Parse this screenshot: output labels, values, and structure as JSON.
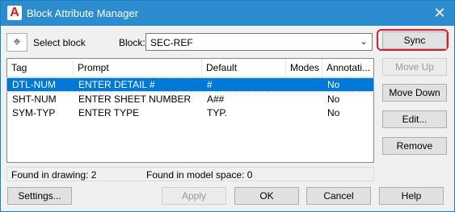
{
  "window": {
    "title": "Block Attribute Manager"
  },
  "toolbar": {
    "select_block_label": "Select block",
    "block_label": "Block:",
    "block_value": "SEC-REF"
  },
  "table": {
    "columns": [
      "Tag",
      "Prompt",
      "Default",
      "Modes",
      "Annotati..."
    ],
    "rows": [
      {
        "tag": "DTL-NUM",
        "prompt": "ENTER DETAIL #",
        "default": "#",
        "modes": "",
        "annotative": "No",
        "selected": true
      },
      {
        "tag": "SHT-NUM",
        "prompt": "ENTER  SHEET NUMBER",
        "default": "A##",
        "modes": "",
        "annotative": "No",
        "selected": false
      },
      {
        "tag": "SYM-TYP",
        "prompt": "ENTER  TYPE",
        "default": "TYP.",
        "modes": "",
        "annotative": "No",
        "selected": false
      }
    ]
  },
  "side_buttons": {
    "sync": "Sync",
    "move_up": "Move Up",
    "move_down": "Move Down",
    "edit": "Edit...",
    "remove": "Remove"
  },
  "status": {
    "found_in_drawing": "Found in drawing: 2",
    "found_in_model_space": "Found in model space: 0"
  },
  "bottom_buttons": {
    "settings": "Settings...",
    "apply": "Apply",
    "ok": "OK",
    "cancel": "Cancel",
    "help": "Help"
  },
  "colors": {
    "titlebar": "#2b8dd0",
    "selection": "#0078d7",
    "sync_highlight": "#d21f2b"
  }
}
